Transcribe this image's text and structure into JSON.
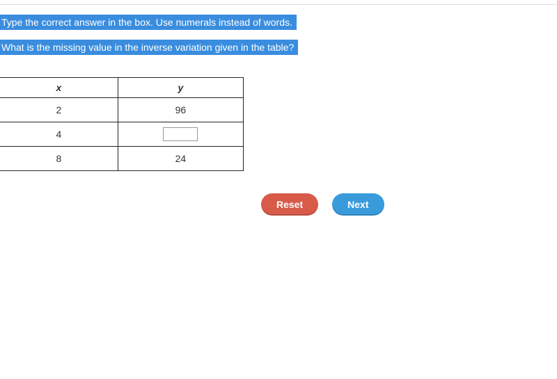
{
  "instructions": {
    "line1": "Type the correct answer in the box. Use numerals instead of words.",
    "line2": "What is the missing value in the inverse variation given in the table?"
  },
  "table": {
    "headers": {
      "x": "x",
      "y": "y"
    },
    "rows": [
      {
        "x": "2",
        "y": "96"
      },
      {
        "x": "4",
        "y": ""
      },
      {
        "x": "8",
        "y": "24"
      }
    ],
    "input_row_index": 1
  },
  "buttons": {
    "reset": "Reset",
    "next": "Next"
  }
}
